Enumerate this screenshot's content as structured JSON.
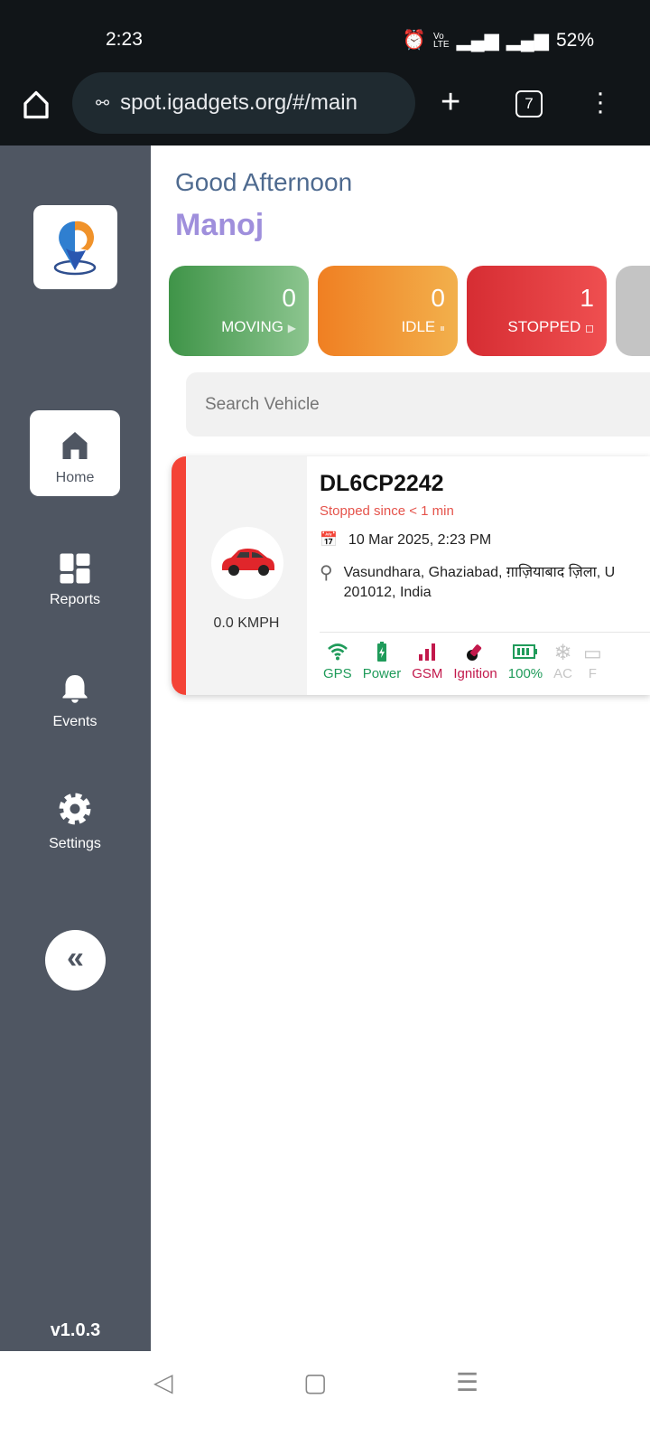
{
  "status_bar": {
    "time": "2:23",
    "battery": "52%",
    "network": "4G"
  },
  "browser": {
    "url": "spot.igadgets.org/#/main",
    "tab_count": "7"
  },
  "sidebar": {
    "items": [
      {
        "label": "Home",
        "icon": "home-icon",
        "active": true
      },
      {
        "label": "Reports",
        "icon": "grid-icon"
      },
      {
        "label": "Events",
        "icon": "bell-icon"
      },
      {
        "label": "Settings",
        "icon": "gear-icon"
      }
    ],
    "version": "v1.0.3"
  },
  "greeting": "Good Afternoon",
  "user_name": "Manoj",
  "stats": [
    {
      "count": "0",
      "label": "MOVING",
      "symbol": "▶",
      "color": "#43a047"
    },
    {
      "count": "0",
      "label": "IDLE",
      "symbol": "⏸",
      "color": "#f39c2b"
    },
    {
      "count": "1",
      "label": "STOPPED",
      "symbol": "◻",
      "color": "#e53935"
    }
  ],
  "search": {
    "placeholder": "Search Vehicle"
  },
  "vehicle": {
    "plate": "DL6CP2242",
    "status": "Stopped since < 1 min",
    "speed": "0.0 KMPH",
    "datetime": "10 Mar 2025, 2:23 PM",
    "address_line1": "Vasundhara, Ghaziabad, ग़ाज़ियाबाद ज़िला, U",
    "address_line2": "201012, India",
    "indicators": [
      {
        "label": "GPS",
        "state": "ok"
      },
      {
        "label": "Power",
        "state": "ok"
      },
      {
        "label": "GSM",
        "state": "warn"
      },
      {
        "label": "Ignition",
        "state": "warn"
      },
      {
        "label": "100%",
        "state": "ok"
      },
      {
        "label": "AC",
        "state": "off"
      },
      {
        "label": "F",
        "state": "off"
      }
    ]
  }
}
